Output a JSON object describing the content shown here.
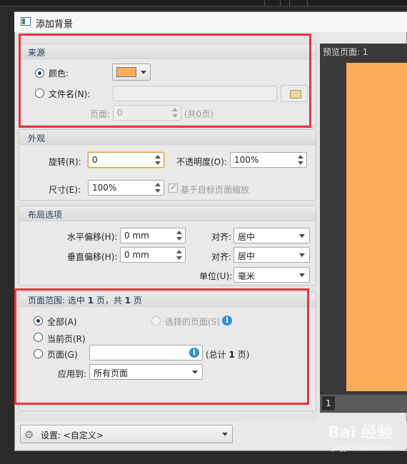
{
  "window": {
    "title": "添加背景"
  },
  "colors": {
    "accent": "#1c3d6b",
    "background_color": "#ffad5b",
    "highlight_box": "#e8353b",
    "info": "#2e8fd6"
  },
  "source": {
    "title": "来源",
    "color_label": "颜色:",
    "filename_label": "文件名(N):",
    "filename_value": "",
    "page_label": "页面:",
    "page_value": "0",
    "page_total": "(共0页)"
  },
  "appearance": {
    "title": "外观",
    "rotation_label": "旋转(R):",
    "rotation_value": "0",
    "opacity_label": "不透明度(O):",
    "opacity_value": "100%",
    "size_label": "尺寸(E):",
    "size_value": "100%",
    "scale_checkbox_label": "基于目标页面缩放"
  },
  "layout": {
    "title": "布局选项",
    "h_offset_label": "水平偏移(H):",
    "h_offset_value": "0 mm",
    "h_align_label": "对齐:",
    "h_align_value": "居中",
    "v_offset_label": "垂直偏移(H):",
    "v_offset_value": "0 mm",
    "v_align_label": "对齐:",
    "v_align_value": "居中",
    "unit_label": "单位(U):",
    "unit_value": "毫米"
  },
  "page_range": {
    "title_prefix": "页面范围: 选中",
    "selected_count": "1",
    "title_middle": "页，共",
    "total_count": "1",
    "title_suffix": "页",
    "all_label": "全部(A)",
    "selected_pages_label": "选择的页面(S)",
    "current_page_label": "当前页(R)",
    "pages_label": "页面(G)",
    "pages_value": "",
    "total_prefix": "(总计",
    "total_value": "1",
    "total_suffix": "页)",
    "apply_to_label": "应用到:",
    "apply_to_value": "所有页面"
  },
  "preview": {
    "title": "预览页面: 1",
    "page_number": "1"
  },
  "settings": {
    "label": "设置: <自定义>"
  },
  "watermark": {
    "main": "Bai 经验",
    "sub": "jingyan.baidu.com"
  }
}
